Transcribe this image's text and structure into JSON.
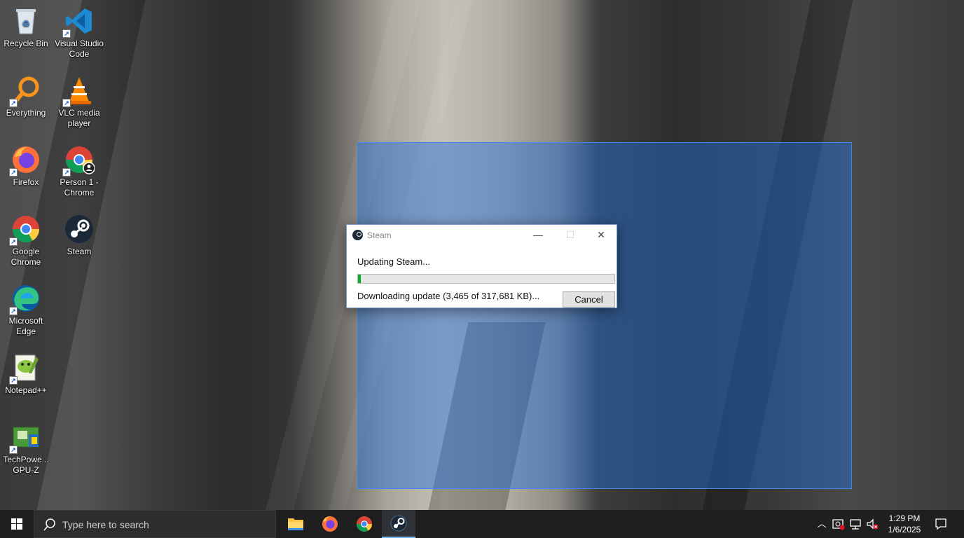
{
  "desktop": {
    "icons": [
      {
        "label": "Recycle Bin",
        "icon": "recycle-bin-icon"
      },
      {
        "label": "Visual Studio Code",
        "icon": "vscode-icon"
      },
      {
        "label": "Everything",
        "icon": "everything-search-icon"
      },
      {
        "label": "VLC media player",
        "icon": "vlc-icon"
      },
      {
        "label": "Firefox",
        "icon": "firefox-icon"
      },
      {
        "label": "Person 1 - Chrome",
        "icon": "chrome-profile-icon"
      },
      {
        "label": "Google Chrome",
        "icon": "chrome-icon"
      },
      {
        "label": "Steam",
        "icon": "steam-icon"
      },
      {
        "label": "Microsoft Edge",
        "icon": "edge-icon"
      },
      {
        "label": "Notepad++",
        "icon": "notepadplusplus-icon"
      },
      {
        "label": "TechPowe... GPU-Z",
        "icon": "gpuz-icon"
      }
    ]
  },
  "dialog": {
    "title": "Steam",
    "status": "Updating Steam...",
    "progress_fraction": 0.011,
    "detail": "Downloading update (3,465 of 317,681 KB)...",
    "cancel_label": "Cancel"
  },
  "taskbar": {
    "search_placeholder": "Type here to search",
    "apps": [
      {
        "name": "File Explorer",
        "icon": "folder-icon"
      },
      {
        "name": "Firefox",
        "icon": "firefox-icon"
      },
      {
        "name": "Google Chrome",
        "icon": "chrome-icon"
      },
      {
        "name": "Steam",
        "icon": "steam-icon",
        "active": true
      }
    ],
    "time": "1:29 PM",
    "date": "1/6/2025"
  },
  "colors": {
    "taskbar_bg": "#1f1f1f",
    "selection": "#1e6edc",
    "progress": "#06b025",
    "active_app_underline": "#76b9ed"
  }
}
